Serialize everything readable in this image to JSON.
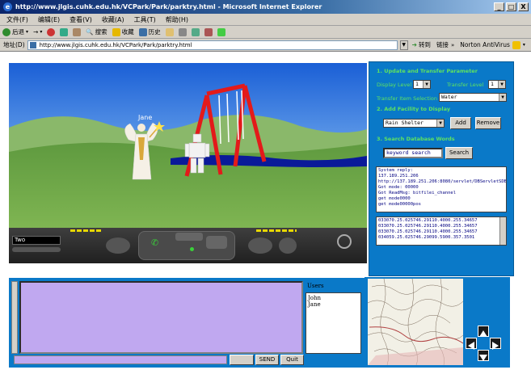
{
  "window": {
    "title": "http://www.jlgis.cuhk.edu.hk/VCPark/Park/parktry.html - Microsoft Internet Explorer",
    "buttons": [
      "_",
      "□",
      "X"
    ]
  },
  "menu": [
    "文件(F)",
    "编辑(E)",
    "查看(V)",
    "收藏(A)",
    "工具(T)",
    "帮助(H)"
  ],
  "toolbar": {
    "back": "后退",
    "search": "搜索",
    "favorites": "收藏",
    "history": "历史"
  },
  "address": {
    "label": "地址(D)",
    "url": "http://www.jlgis.cuhk.edu.hk/VCPark/Park/parktry.html",
    "go": "转到",
    "links": "链接",
    "norton": "Norton AntiVirus"
  },
  "scene": {
    "avatar_name": "Jane",
    "name_field": "Two"
  },
  "panel": {
    "sec1": "1. Update and Transfer Parameter",
    "sec1_label1": "Display Level",
    "sec1_val1": "1",
    "sec1_label2": "Transfer Level",
    "sec1_val2": "1",
    "sec1_label3": "Transfer Item Selection",
    "sec1_val3": "Water",
    "sec2": "2. Add Facility to Display",
    "sec2_val": "Rain Shelter",
    "add": "Add",
    "remove": "Remove",
    "sec3": "3. Search Database Words",
    "search_value": "keyword search",
    "search": "Search",
    "reply_lines": [
      "System reply:",
      "137.189.251.206",
      "http://137.189.251.206:8080/servlet/DBServletSDB",
      "Got mode: 00000",
      "Got ReadMsg: bitfilei_channel",
      "  get mode0000",
      "  get mode00000pos"
    ],
    "list_lines": [
      "033070.25.025746.29110.4000.255.34657",
      "033070.25.025746.29110.4000.255.34657",
      "033070.25.025746.29110.4000.255.34657",
      "034059.25.025746.29099.5900.357.3501"
    ]
  },
  "chat": {
    "users_label": "Users",
    "users": [
      "John",
      "Jane"
    ],
    "send": "SEND",
    "quit": "Quit",
    "blank_btn": ""
  },
  "colors": {
    "panel_bg": "#0a79c8",
    "panel_text": "#5fe35f",
    "chat_bg": "#c0a8f0",
    "swing_red": "#e31a1a"
  }
}
